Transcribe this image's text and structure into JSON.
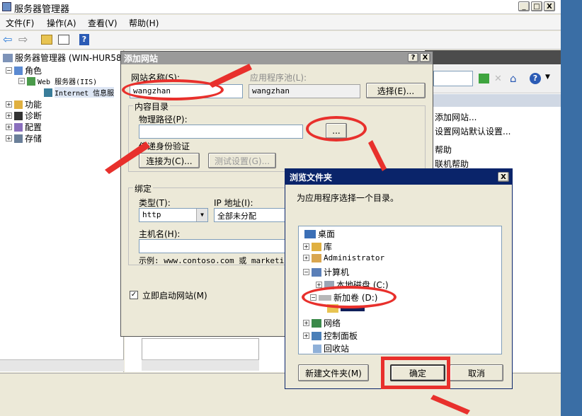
{
  "app": {
    "title": "服务器管理器",
    "window_controls": {
      "min": "_",
      "max": "□",
      "close": "X"
    }
  },
  "menu": [
    "文件(F)",
    "操作(A)",
    "查看(V)",
    "帮助(H)"
  ],
  "tree": {
    "root": "服务器管理器 (WIN-HUR580",
    "roles": "角色",
    "web": "Web 服务器(IIS)",
    "iis": "Internet 信息服",
    "features": "功能",
    "diagnostics": "诊断",
    "config": "配置",
    "storage": "存储"
  },
  "actions": {
    "add_site": "添加网站...",
    "defaults": "设置网站默认设置...",
    "help": "帮助",
    "online_help": "联机帮助"
  },
  "add_site": {
    "title": "添加网站",
    "help_btn": "?",
    "close_btn": "X",
    "site_name_label": "网站名称(S):",
    "site_name_value": "wangzhan",
    "app_pool_label": "应用程序池(L):",
    "app_pool_value": "wangzhan",
    "select_button": "选择(E)...",
    "content_dir": "内容目录",
    "physical_path_label": "物理路径(P):",
    "physical_path_value": "",
    "browse_button": "...",
    "passthrough": "传递身份验证",
    "connect_as": "连接为(C)...",
    "test_settings": "测试设置(G)...",
    "binding": "绑定",
    "type_label": "类型(T):",
    "type_value": "http",
    "ip_label": "IP 地址(I):",
    "ip_value": "全部未分配",
    "host_label": "主机名(H):",
    "host_value": "",
    "example": "示例: www.contoso.com 或 marketing",
    "start_site": "立即启动网站(M)"
  },
  "browse": {
    "title": "浏览文件夹",
    "close": "X",
    "prompt": "为应用程序选择一个目录。",
    "items": [
      {
        "label": "桌面",
        "icon": "desktop-icon"
      },
      {
        "label": "库",
        "icon": "library-icon"
      },
      {
        "label": "Administrator",
        "icon": "user-icon"
      },
      {
        "label": "计算机",
        "icon": "computer-icon"
      },
      {
        "label": "本地磁盘 (C:)",
        "icon": "disk-icon"
      },
      {
        "label": "新加卷 (D:)",
        "icon": "drive-icon"
      },
      {
        "label": "",
        "icon": "folder-icon"
      },
      {
        "label": "网络",
        "icon": "network-icon"
      },
      {
        "label": "控制面板",
        "icon": "control-panel-icon"
      },
      {
        "label": "回收站",
        "icon": "recycle-bin-icon"
      }
    ],
    "new_folder": "新建文件夹(M)",
    "ok": "确定",
    "cancel": "取消"
  },
  "colors": {
    "annotation": "#e8302c",
    "titlebar": "#0a246a",
    "dialog": "#ece9d8"
  }
}
